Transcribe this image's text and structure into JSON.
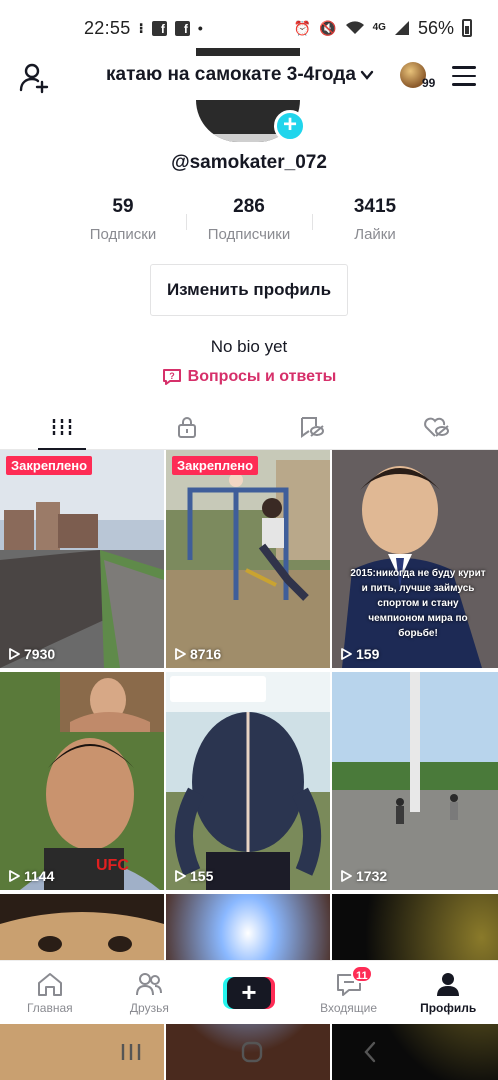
{
  "status_bar": {
    "time": "22:55",
    "network": "4G",
    "battery": "56%"
  },
  "header": {
    "profile_name": "катаю на самокате 3-4года",
    "coin_count": "99"
  },
  "profile": {
    "username": "@samokater_072",
    "stats": [
      {
        "value": "59",
        "label": "Подписки"
      },
      {
        "value": "286",
        "label": "Подписчики"
      },
      {
        "value": "3415",
        "label": "Лайки"
      }
    ],
    "edit_button": "Изменить профиль",
    "bio": "No bio yet",
    "qa_link": "Вопросы и ответы"
  },
  "tabs": [
    "videos-grid",
    "private",
    "liked-hidden",
    "favorites"
  ],
  "videos": [
    {
      "views": "7930",
      "pinned": "Закреплено"
    },
    {
      "views": "8716",
      "pinned": "Закреплено"
    },
    {
      "views": "159",
      "overlay": "2015:никогда не буду курит и пить, лучше займусь спортом и стану чемпионом мира по борьбе!"
    },
    {
      "views": "1144"
    },
    {
      "views": "155"
    },
    {
      "views": "1732"
    },
    {},
    {},
    {}
  ],
  "bottom_nav": {
    "home": "Главная",
    "friends": "Друзья",
    "inbox": "Входящие",
    "inbox_badge": "11",
    "profile": "Профиль"
  },
  "colors": {
    "accent": "#fe2c55",
    "cyan": "#25f4ee",
    "qa_link": "#d6306a"
  }
}
